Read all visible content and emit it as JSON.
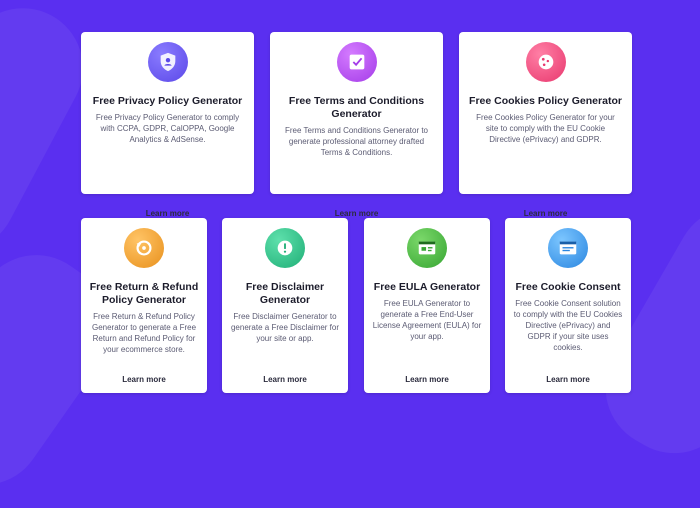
{
  "row1": [
    {
      "title": "Free Privacy Policy Generator",
      "description": "Free Privacy Policy Generator to comply with CCPA, GDPR, CalOPPA, Google Analytics & AdSense.",
      "link": "Learn more",
      "icon": "shield-user-icon",
      "color": "#6b5cf0"
    },
    {
      "title": "Free Terms and Conditions Generator",
      "description": "Free Terms and Conditions Generator to generate professional attorney drafted Terms & Conditions.",
      "link": "Learn more",
      "icon": "document-check-icon",
      "color": "#b04ef0"
    },
    {
      "title": "Free Cookies Policy Generator",
      "description": "Free Cookies Policy Generator for your site to comply with the EU Cookie Directive (ePrivacy) and GDPR.",
      "link": "Learn more",
      "icon": "cookie-icon",
      "color": "#f0447a"
    }
  ],
  "row2": [
    {
      "title": "Free Return & Refund Policy Generator",
      "description": "Free Return & Refund Policy Generator to generate a Free Return and Refund Policy for your ecommerce store.",
      "link": "Learn more",
      "icon": "return-arrow-icon",
      "color": "#f0a030"
    },
    {
      "title": "Free Disclaimer Generator",
      "description": "Free Disclaimer Generator to generate a Free Disclaimer for your site or app.",
      "link": "Learn more",
      "icon": "exclamation-icon",
      "color": "#2cc48a"
    },
    {
      "title": "Free EULA Generator",
      "description": "Free EULA Generator to generate a Free End-User License Agreement (EULA) for your app.",
      "link": "Learn more",
      "icon": "app-window-icon",
      "color": "#48b548"
    },
    {
      "title": "Free Cookie Consent",
      "description": "Free Cookie Consent solution to comply with the EU Cookies Directive (ePrivacy) and GDPR if your site uses cookies.",
      "link": "Learn more",
      "icon": "browser-window-icon",
      "color": "#3a9ff0"
    }
  ]
}
